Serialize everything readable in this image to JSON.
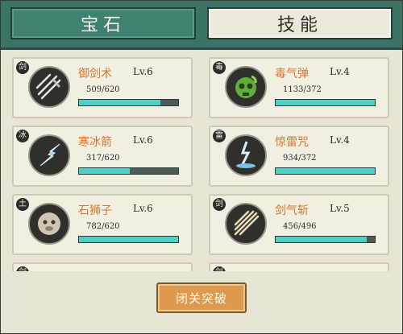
{
  "tabs": {
    "gem": "宝石",
    "skill": "技能"
  },
  "skills": [
    {
      "badge": "剑",
      "name": "御剑术",
      "level": "Lv.6",
      "count": "509/620",
      "progress": 0.82,
      "icon": "flying-swords-icon"
    },
    {
      "badge": "毒",
      "name": "毒气弹",
      "level": "Lv.4",
      "count": "1133/372",
      "progress": 1.0,
      "icon": "poison-skull-icon"
    },
    {
      "badge": "冰",
      "name": "寒冰箭",
      "level": "Lv.6",
      "count": "317/620",
      "progress": 0.51,
      "icon": "ice-arrow-icon"
    },
    {
      "badge": "雷",
      "name": "惊雷咒",
      "level": "Lv.4",
      "count": "934/372",
      "progress": 1.0,
      "icon": "lightning-icon"
    },
    {
      "badge": "土",
      "name": "石狮子",
      "level": "Lv.6",
      "count": "782/620",
      "progress": 1.0,
      "icon": "stone-lion-icon"
    },
    {
      "badge": "剑",
      "name": "剑气斩",
      "level": "Lv.5",
      "count": "456/496",
      "progress": 0.92,
      "icon": "sword-qi-icon"
    }
  ],
  "peek_badges": [
    "剑",
    "剑"
  ],
  "footer": {
    "button_label": "闭关突破"
  }
}
